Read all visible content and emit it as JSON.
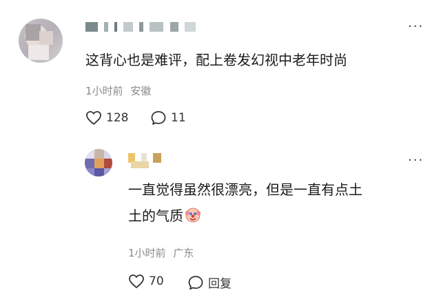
{
  "comment": {
    "text": "这背心也是难评，配上卷发幻视中老年时尚",
    "time": "1小时前",
    "location": "安徽",
    "likes": "128",
    "replies": "11",
    "more_icon": "more-dots-icon"
  },
  "reply": {
    "text_line1": "一直觉得虽然很漂亮，但是一直有点土",
    "text_line2": "土的气质",
    "time": "1小时前",
    "location": "广东",
    "likes": "70",
    "reply_label": "回复",
    "emoji_icon": "clown-face-icon"
  },
  "colors": {
    "text": "#1a1a1a",
    "meta": "#8a8a8a",
    "background": "#ffffff"
  }
}
